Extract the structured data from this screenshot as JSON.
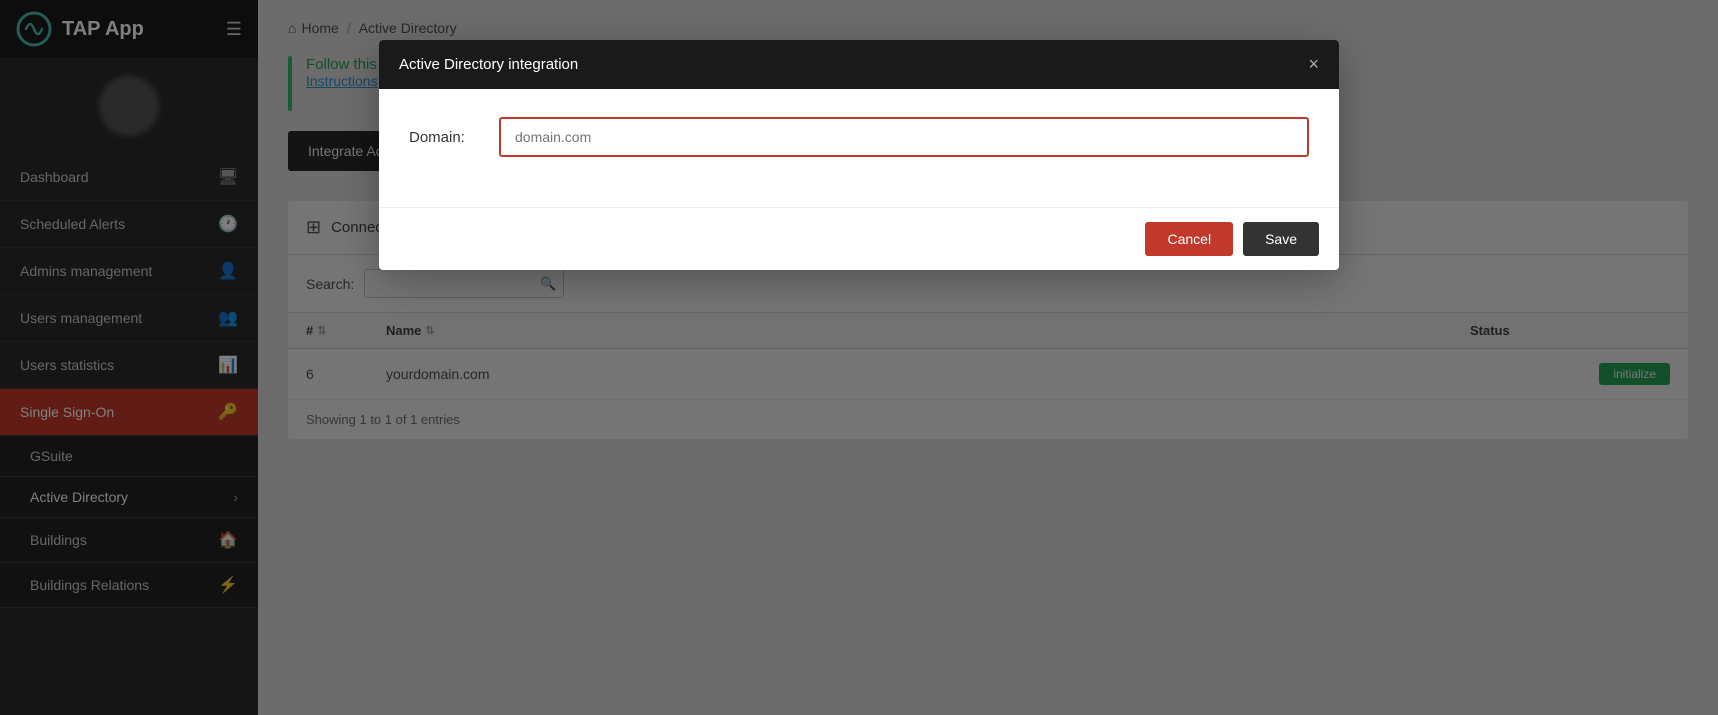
{
  "app": {
    "title": "TAP App",
    "menu_icon": "☰"
  },
  "sidebar": {
    "items": [
      {
        "id": "dashboard",
        "label": "Dashboard",
        "icon": "🖥"
      },
      {
        "id": "scheduled-alerts",
        "label": "Scheduled Alerts",
        "icon": "🕐"
      },
      {
        "id": "admins-management",
        "label": "Admins management",
        "icon": "👤"
      },
      {
        "id": "users-management",
        "label": "Users management",
        "icon": "👥"
      },
      {
        "id": "users-statistics",
        "label": "Users statistics",
        "icon": "📊"
      },
      {
        "id": "single-sign-on",
        "label": "Single Sign-On",
        "icon": "🔑"
      }
    ],
    "sub_items": [
      {
        "id": "gsuite",
        "label": "GSuite"
      },
      {
        "id": "active-directory",
        "label": "Active Directory",
        "arrow": "›"
      },
      {
        "id": "buildings",
        "label": "Buildings",
        "icon": "🏠"
      },
      {
        "id": "buildings-relations",
        "label": "Buildings Relations",
        "icon": "⚡"
      }
    ]
  },
  "breadcrumb": {
    "home": "Home",
    "separator": "/",
    "current": "Active Directory"
  },
  "content": {
    "info_text": "Follow this link for more info:",
    "info_link": "Instructions",
    "integrate_button": "Integrate Active Directory app",
    "table_title": "Connected Active Directory Organizations",
    "search_label": "Search:",
    "search_placeholder": "",
    "columns": {
      "num": "#",
      "name": "Name",
      "status": "Status"
    },
    "rows": [
      {
        "num": "6",
        "name": "yourdomain.com",
        "status": "initialize"
      }
    ],
    "footer_text": "Showing 1 to 1 of 1 entries"
  },
  "modal": {
    "title": "Active Directory integration",
    "close_label": "×",
    "domain_label": "Domain:",
    "domain_placeholder": "domain.com",
    "cancel_label": "Cancel",
    "save_label": "Save"
  }
}
